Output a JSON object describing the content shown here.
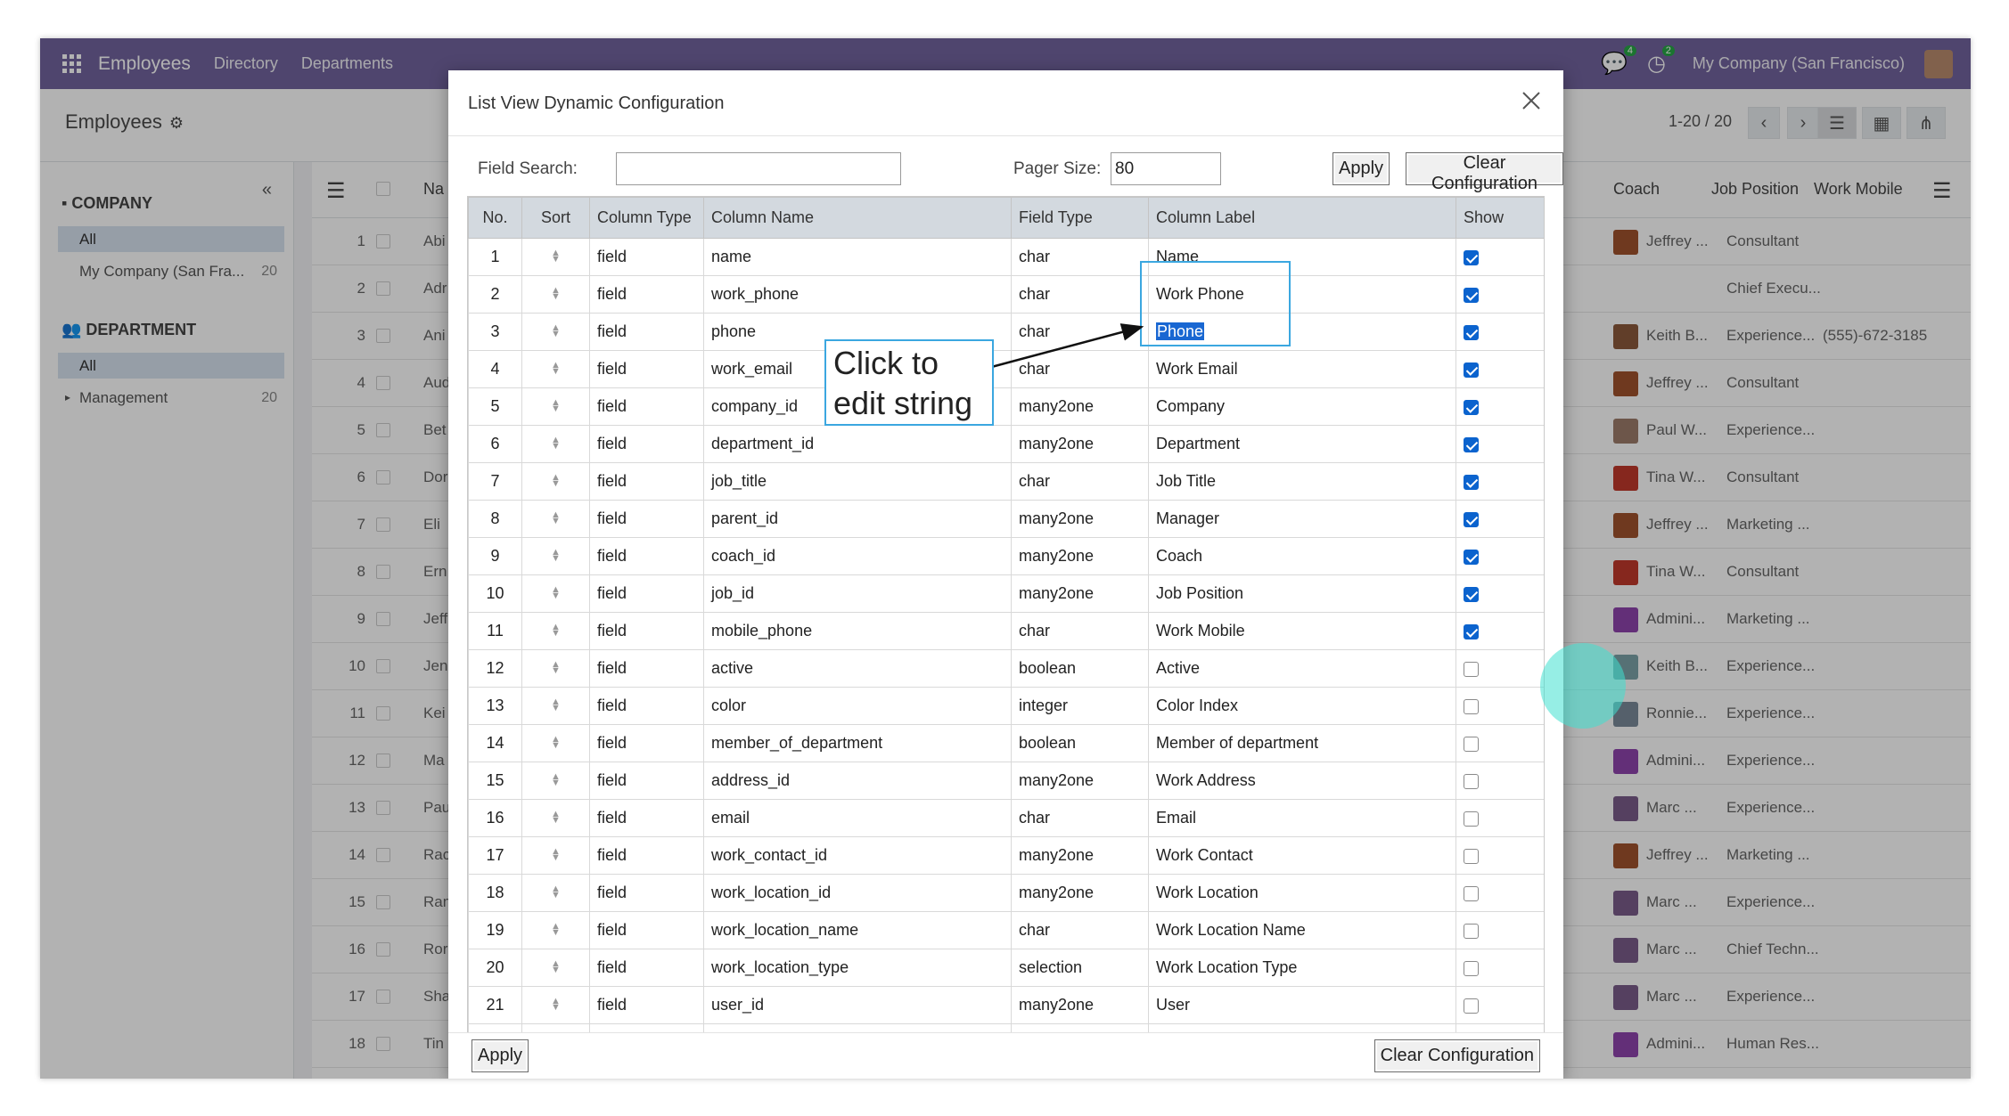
{
  "navbar": {
    "brand": "Employees",
    "links": [
      "Directory",
      "Departments"
    ],
    "chat_badge": "4",
    "activity_badge": "2",
    "company": "My Company (San Francisco)"
  },
  "control_panel": {
    "title": "Employees",
    "pager": "1-20 / 20"
  },
  "sidebar": {
    "company_heading": "COMPANY",
    "company_items": [
      {
        "label": "All",
        "count": ""
      },
      {
        "label": "My Company (San Fra...",
        "count": "20"
      }
    ],
    "department_heading": "DEPARTMENT",
    "department_items": [
      {
        "label": "All",
        "count": ""
      },
      {
        "label": "Management",
        "count": "20"
      }
    ]
  },
  "background_list": {
    "headers": {
      "name": "Na",
      "coach": "Coach",
      "job_position": "Job Position",
      "work_mobile": "Work Mobile"
    },
    "rows": [
      {
        "no": "1",
        "name": "Abi",
        "coach": "Jeffrey ...",
        "position": "Consultant",
        "mobile": ""
      },
      {
        "no": "2",
        "name": "Adr",
        "coach": "",
        "position": "Chief Execu...",
        "mobile": ""
      },
      {
        "no": "3",
        "name": "Ani",
        "coach": "Keith B...",
        "position": "Experience...",
        "mobile": "(555)-672-3185"
      },
      {
        "no": "4",
        "name": "Aud",
        "coach": "Jeffrey ...",
        "position": "Consultant",
        "mobile": ""
      },
      {
        "no": "5",
        "name": "Bet",
        "coach": "Paul W...",
        "position": "Experience...",
        "mobile": ""
      },
      {
        "no": "6",
        "name": "Dor",
        "coach": "Tina W...",
        "position": "Consultant",
        "mobile": ""
      },
      {
        "no": "7",
        "name": "Eli",
        "coach": "Jeffrey ...",
        "position": "Marketing ...",
        "mobile": ""
      },
      {
        "no": "8",
        "name": "Ern",
        "coach": "Tina W...",
        "position": "Consultant",
        "mobile": ""
      },
      {
        "no": "9",
        "name": "Jeff",
        "coach": "Admini...",
        "position": "Marketing ...",
        "mobile": ""
      },
      {
        "no": "10",
        "name": "Jen",
        "coach": "Keith B...",
        "position": "Experience...",
        "mobile": ""
      },
      {
        "no": "11",
        "name": "Kei",
        "coach": "Ronnie...",
        "position": "Experience...",
        "mobile": ""
      },
      {
        "no": "12",
        "name": "Ma",
        "coach": "Admini...",
        "position": "Experience...",
        "mobile": ""
      },
      {
        "no": "13",
        "name": "Pau",
        "coach": "Marc ...",
        "position": "Experience...",
        "mobile": ""
      },
      {
        "no": "14",
        "name": "Rac",
        "coach": "Jeffrey ...",
        "position": "Marketing ...",
        "mobile": ""
      },
      {
        "no": "15",
        "name": "Ran",
        "coach": "Marc ...",
        "position": "Experience...",
        "mobile": ""
      },
      {
        "no": "16",
        "name": "Ror",
        "coach": "Marc ...",
        "position": "Chief Techn...",
        "mobile": ""
      },
      {
        "no": "17",
        "name": "Sha",
        "coach": "Marc ...",
        "position": "Experience...",
        "mobile": ""
      },
      {
        "no": "18",
        "name": "Tin",
        "coach": "Admini...",
        "position": "Human Res...",
        "mobile": ""
      }
    ]
  },
  "modal": {
    "title": "List View Dynamic Configuration",
    "field_search_label": "Field Search:",
    "field_search_value": "",
    "pager_size_label": "Pager Size:",
    "pager_size_value": "80",
    "apply_label": "Apply",
    "clear_label": "Clear Configuration",
    "columns": {
      "no": "No.",
      "sort": "Sort",
      "type": "Column Type",
      "name": "Column Name",
      "field_type": "Field Type",
      "label": "Column Label",
      "show": "Show"
    },
    "rows": [
      {
        "no": "1",
        "type": "field",
        "name": "name",
        "field_type": "char",
        "label": "Name",
        "show": true
      },
      {
        "no": "2",
        "type": "field",
        "name": "work_phone",
        "field_type": "char",
        "label": "Work Phone",
        "show": true
      },
      {
        "no": "3",
        "type": "field",
        "name": "phone",
        "field_type": "char",
        "label": "Phone",
        "show": true
      },
      {
        "no": "4",
        "type": "field",
        "name": "work_email",
        "field_type": "char",
        "label": "Work Email",
        "show": true
      },
      {
        "no": "5",
        "type": "field",
        "name": "company_id",
        "field_type": "many2one",
        "label": "Company",
        "show": true
      },
      {
        "no": "6",
        "type": "field",
        "name": "department_id",
        "field_type": "many2one",
        "label": "Department",
        "show": true
      },
      {
        "no": "7",
        "type": "field",
        "name": "job_title",
        "field_type": "char",
        "label": "Job Title",
        "show": true
      },
      {
        "no": "8",
        "type": "field",
        "name": "parent_id",
        "field_type": "many2one",
        "label": "Manager",
        "show": true
      },
      {
        "no": "9",
        "type": "field",
        "name": "coach_id",
        "field_type": "many2one",
        "label": "Coach",
        "show": true
      },
      {
        "no": "10",
        "type": "field",
        "name": "job_id",
        "field_type": "many2one",
        "label": "Job Position",
        "show": true
      },
      {
        "no": "11",
        "type": "field",
        "name": "mobile_phone",
        "field_type": "char",
        "label": "Work Mobile",
        "show": true
      },
      {
        "no": "12",
        "type": "field",
        "name": "active",
        "field_type": "boolean",
        "label": "Active",
        "show": false
      },
      {
        "no": "13",
        "type": "field",
        "name": "color",
        "field_type": "integer",
        "label": "Color Index",
        "show": false
      },
      {
        "no": "14",
        "type": "field",
        "name": "member_of_department",
        "field_type": "boolean",
        "label": "Member of department",
        "show": false
      },
      {
        "no": "15",
        "type": "field",
        "name": "address_id",
        "field_type": "many2one",
        "label": "Work Address",
        "show": false
      },
      {
        "no": "16",
        "type": "field",
        "name": "email",
        "field_type": "char",
        "label": "Email",
        "show": false
      },
      {
        "no": "17",
        "type": "field",
        "name": "work_contact_id",
        "field_type": "many2one",
        "label": "Work Contact",
        "show": false
      },
      {
        "no": "18",
        "type": "field",
        "name": "work_location_id",
        "field_type": "many2one",
        "label": "Work Location",
        "show": false
      },
      {
        "no": "19",
        "type": "field",
        "name": "work_location_name",
        "field_type": "char",
        "label": "Work Location Name",
        "show": false
      },
      {
        "no": "20",
        "type": "field",
        "name": "work_location_type",
        "field_type": "selection",
        "label": "Work Location Type",
        "show": false
      },
      {
        "no": "21",
        "type": "field",
        "name": "user_id",
        "field_type": "many2one",
        "label": "User",
        "show": false
      }
    ]
  },
  "annotation": {
    "callout_line1": "Click to",
    "callout_line2": "edit string"
  },
  "colors": {
    "navbar": "#71639e",
    "accent": "#3ba7e0",
    "checkbox": "#0b63ce",
    "selection": "#1967d2"
  },
  "icons": [
    "apps-grid-icon",
    "settings-gear-icon",
    "chat-icon",
    "activity-clock-icon",
    "chevron-left-icon",
    "chevron-right-icon",
    "list-view-icon",
    "kanban-view-icon",
    "org-chart-icon",
    "building-icon",
    "people-icon",
    "close-icon",
    "sort-handle-icon",
    "column-settings-icon"
  ]
}
